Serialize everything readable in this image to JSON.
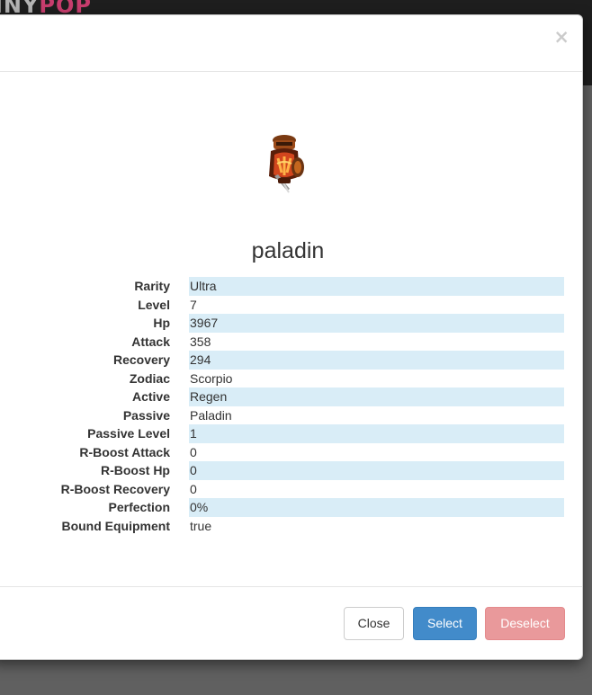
{
  "app": {
    "brand_prefix": "INY",
    "brand_accent": "POP"
  },
  "modal": {
    "close_symbol": "×"
  },
  "pet": {
    "name": "paladin",
    "image_icon": "armored-paladin-sprite-icon"
  },
  "stats": [
    {
      "label": "Rarity",
      "value": "Ultra"
    },
    {
      "label": "Level",
      "value": "7"
    },
    {
      "label": "Hp",
      "value": "3967"
    },
    {
      "label": "Attack",
      "value": "358"
    },
    {
      "label": "Recovery",
      "value": "294"
    },
    {
      "label": "Zodiac",
      "value": "Scorpio"
    },
    {
      "label": "Active",
      "value": "Regen"
    },
    {
      "label": "Passive",
      "value": "Paladin"
    },
    {
      "label": "Passive Level",
      "value": "1"
    },
    {
      "label": "R-Boost Attack",
      "value": "0"
    },
    {
      "label": "R-Boost Hp",
      "value": "0"
    },
    {
      "label": "R-Boost Recovery",
      "value": "0"
    },
    {
      "label": "Perfection",
      "value": "0%"
    },
    {
      "label": "Bound Equipment",
      "value": "true"
    }
  ],
  "footer": {
    "close_label": "Close",
    "select_label": "Select",
    "deselect_label": "Deselect"
  },
  "colors": {
    "stripe": "#d9edf7",
    "primary": "#428bca",
    "danger_disabled": "#e9999b",
    "brand_accent": "#e0457b"
  }
}
